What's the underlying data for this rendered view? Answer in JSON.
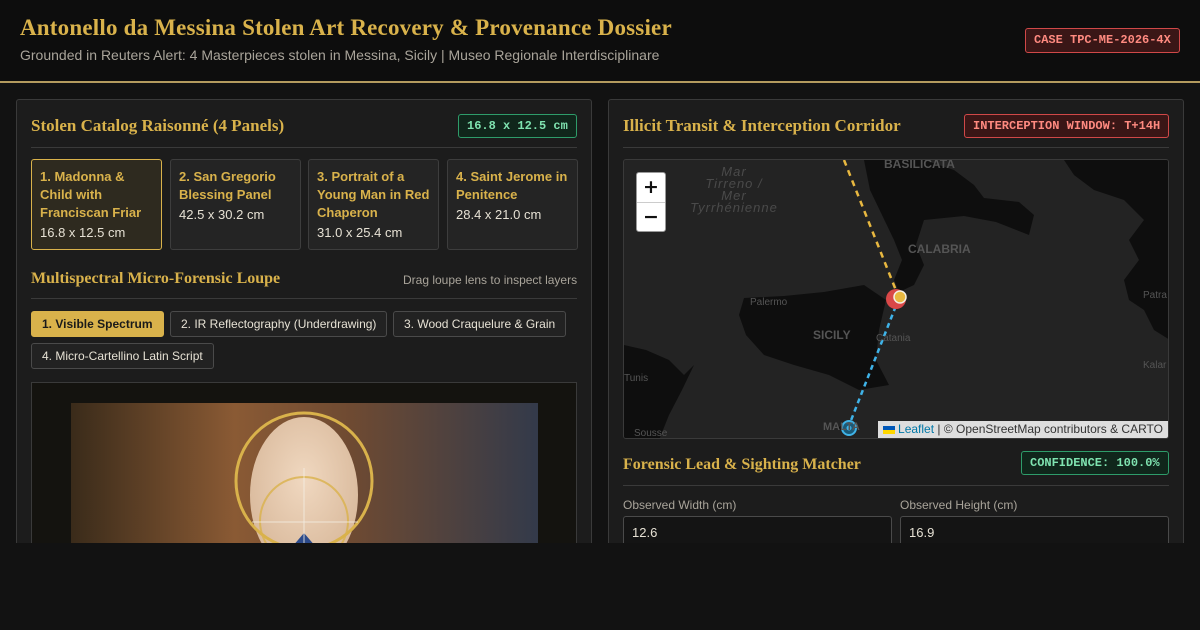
{
  "header": {
    "title": "Antonello da Messina Stolen Art Recovery & Provenance Dossier",
    "subtitle": "Grounded in Reuters Alert: 4 Masterpieces stolen in Messina, Sicily | Museo Regionale Interdisciplinare",
    "case_badge": "CASE TPC-ME-2026-4X"
  },
  "catalog": {
    "title": "Stolen Catalog Raisonné (4 Panels)",
    "dims_badge": "16.8 x 12.5 cm",
    "works": [
      {
        "title": "1. Madonna & Child with Franciscan Friar",
        "dims": "16.8 x 12.5 cm"
      },
      {
        "title": "2. San Gregorio Blessing Panel",
        "dims": "42.5 x 30.2 cm"
      },
      {
        "title": "3. Portrait of a Young Man in Red Chaperon",
        "dims": "31.0 x 25.4 cm"
      },
      {
        "title": "4. Saint Jerome in Penitence",
        "dims": "28.4 x 21.0 cm"
      }
    ]
  },
  "loupe": {
    "title": "Multispectral Micro-Forensic Loupe",
    "hint": "Drag loupe lens to inspect layers",
    "layers": [
      "1. Visible Spectrum",
      "2. IR Reflectography (Underdrawing)",
      "3. Wood Craquelure & Grain",
      "4. Micro-Cartellino Latin Script"
    ]
  },
  "transit": {
    "title": "Illicit Transit & Interception Corridor",
    "window_badge": "INTERCEPTION WINDOW: T+14H",
    "map": {
      "sea_label": [
        "Mar",
        "Tirreno /",
        "Mer",
        "Tyrrhénienne"
      ],
      "labels": {
        "basilicata": "BASILICATA",
        "calabria": "CALABRIA",
        "sicily": "SICILY",
        "palermo": "Palermo",
        "catania": "Catania",
        "tunis": "Tunis",
        "sousse": "Sousse",
        "malta": "MALTA",
        "patra": "Patra",
        "kalar": "Kalar"
      },
      "zoom_in": "+",
      "zoom_out": "−",
      "attribution_link": "Leaflet",
      "attribution_text": " | © OpenStreetMap contributors & CARTO"
    }
  },
  "matcher": {
    "title": "Forensic Lead & Sighting Matcher",
    "confidence_badge": "CONFIDENCE: 100.0%",
    "width_label": "Observed Width (cm)",
    "width_value": "12.6",
    "height_label": "Observed Height (cm)",
    "height_value": "16.9"
  },
  "colors": {
    "accent_gold": "#d9b24b",
    "alert_red": "#d04848",
    "confirm_green": "#2e9c6a",
    "route_north": "#e8b840",
    "route_south": "#3fb3e8"
  }
}
